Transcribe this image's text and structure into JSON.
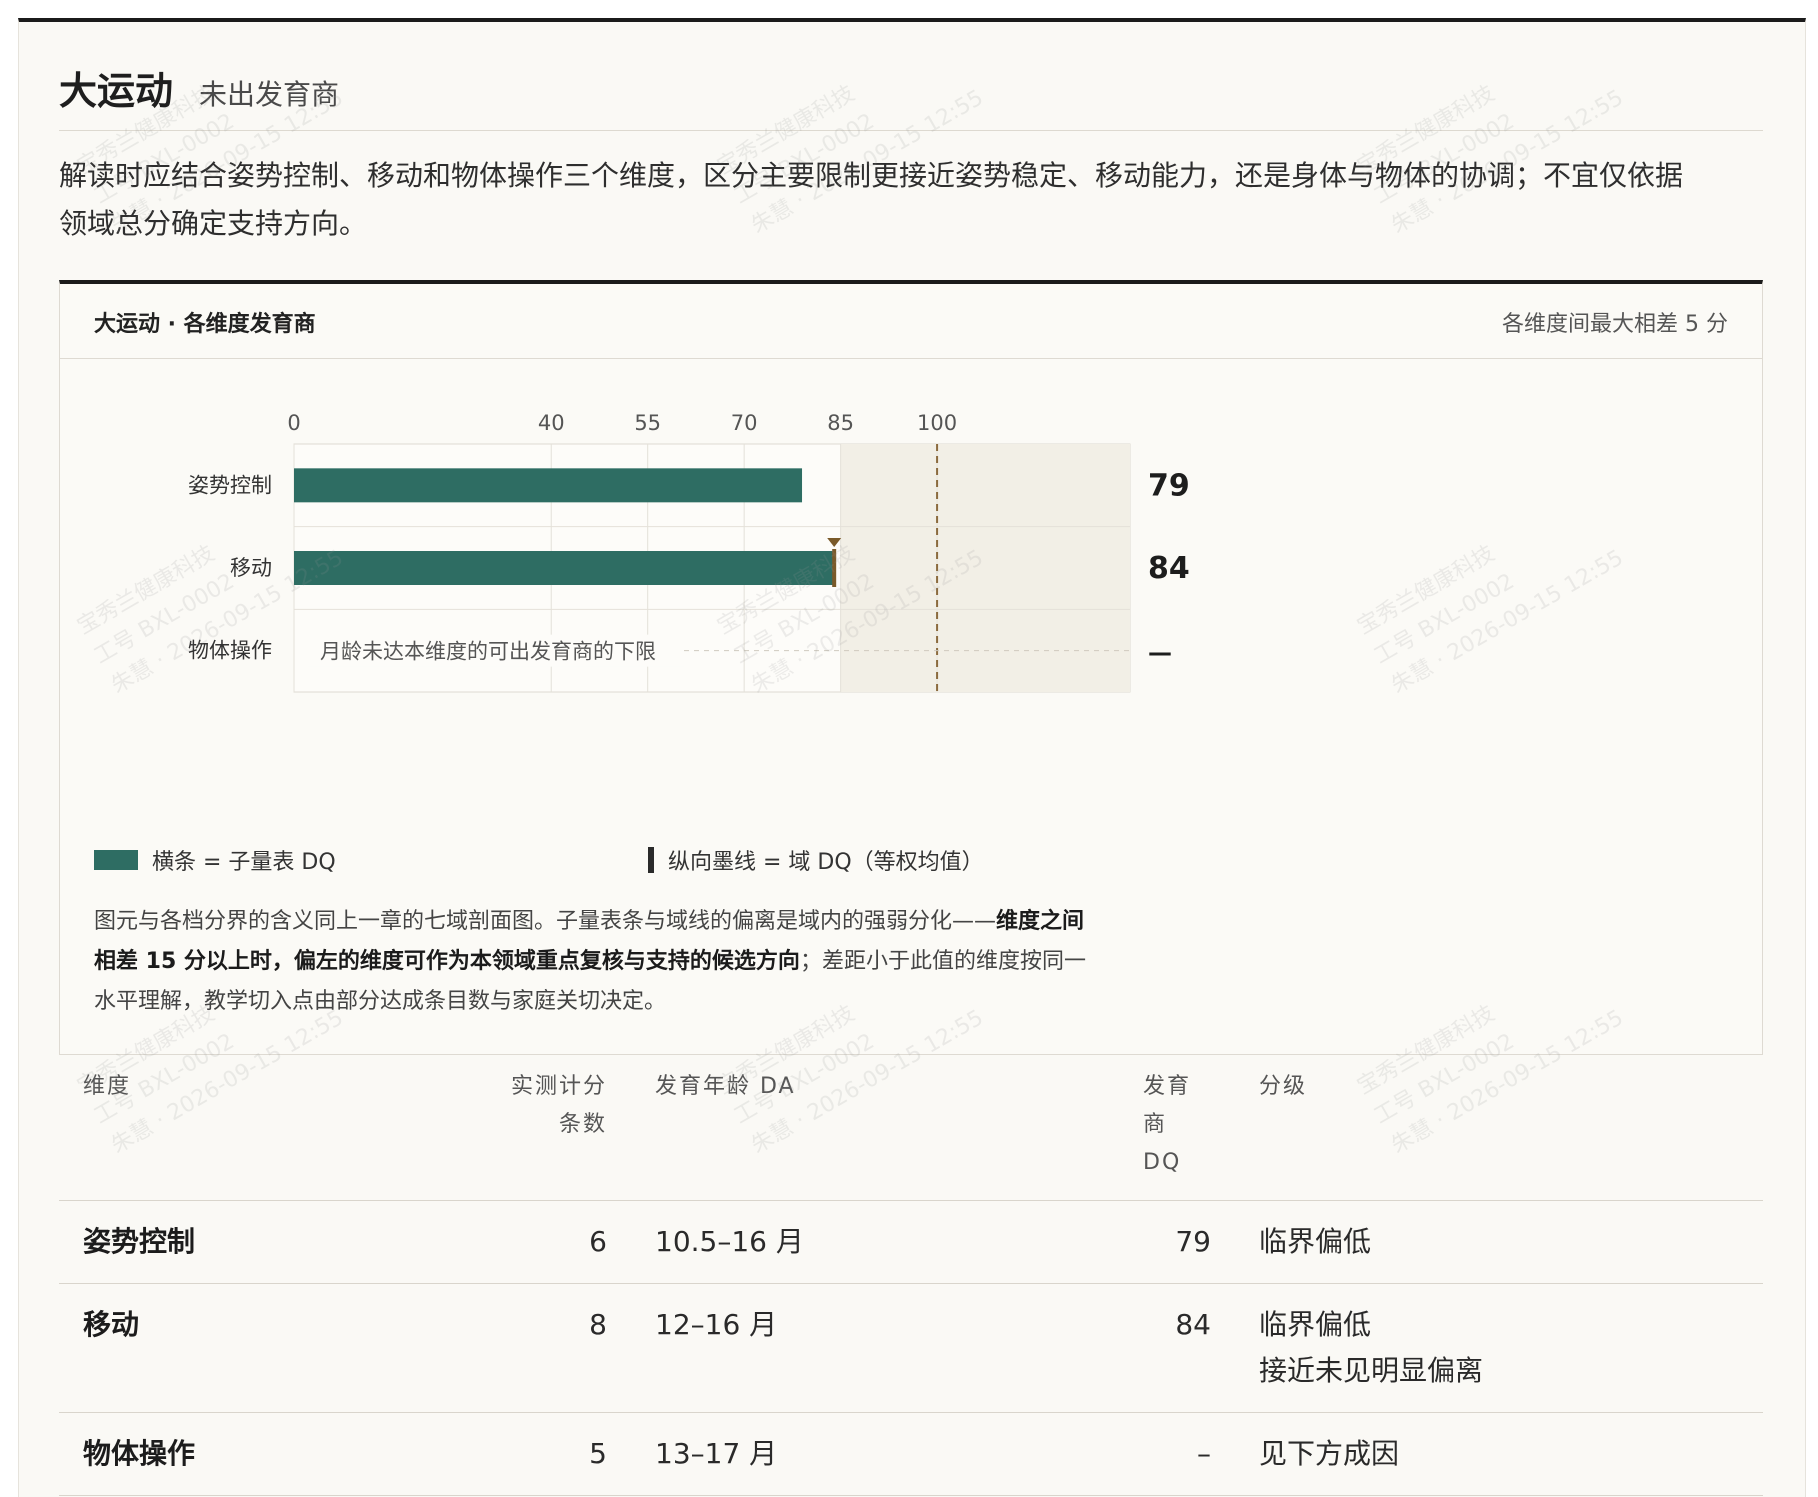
{
  "header": {
    "title": "大运动",
    "subtitle": "未出发育商"
  },
  "description": "解读时应结合姿势控制、移动和物体操作三个维度，区分主要限制更接近姿势稳定、移动能力，还是身体与物体的协调；不宜仅依据领域总分确定支持方向。",
  "card": {
    "title": "大运动 · 各维度发育商",
    "note": "各维度间最大相差 5 分"
  },
  "chart_data": {
    "type": "bar",
    "orientation": "horizontal",
    "categories": [
      "姿势控制",
      "移动",
      "物体操作"
    ],
    "values": [
      79,
      84,
      null
    ],
    "value_labels": [
      "79",
      "84",
      "—"
    ],
    "missing_note": "月龄未达本维度的可出发育商的下限",
    "x_ticks": [
      0,
      40,
      55,
      70,
      85,
      100
    ],
    "xlim": [
      0,
      130
    ],
    "shaded_band": [
      85,
      130
    ],
    "reference_line": 100,
    "domain_dq": 84,
    "grid": true,
    "colors": {
      "bar": "#2e6d63",
      "marker": "#7a5a2a",
      "reference": "#8b6a3e",
      "band": "#f2efe6"
    }
  },
  "legend": {
    "bar": "横条 = 子量表 DQ",
    "line": "纵向墨线 = 域 DQ（等权均值）"
  },
  "caption": {
    "part1": "图元与各档分界的含义同上一章的七域剖面图。子量表条与域线的偏离是域内的强弱分化——",
    "bold": "维度之间相差 15 分以上时，偏左的维度可作为本领域重点复核与支持的候选方向",
    "part2": "；差距小于此值的维度按同一水平理解，教学切入点由部分达成条目数与家庭关切决定。"
  },
  "table": {
    "headers": {
      "dimension": "维度",
      "items": "实测计分条数",
      "da": "发育年龄 DA",
      "dq": "发育商 DQ",
      "level": "分级"
    },
    "rows": [
      {
        "dimension": "姿势控制",
        "items": "6",
        "da": "10.5–16 月",
        "dq": "79",
        "level": "临界偏低",
        "level_note": ""
      },
      {
        "dimension": "移动",
        "items": "8",
        "da": "12–16 月",
        "dq": "84",
        "level": "临界偏低",
        "level_note": "接近未见明显偏离"
      },
      {
        "dimension": "物体操作",
        "items": "5",
        "da": "13–17 月",
        "dq": "–",
        "level": "见下方成因",
        "level_note": ""
      }
    ]
  },
  "watermark": {
    "company": "宝秀兰健康科技",
    "id": "工号 BXL-0002",
    "user": "朱慧",
    "datetime": "2026-09-15 12:55"
  }
}
